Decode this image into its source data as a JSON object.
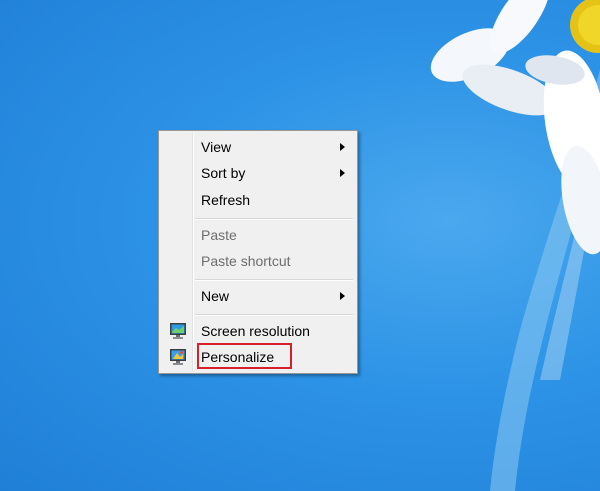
{
  "desktop": {
    "context_menu": {
      "items": [
        {
          "label": "View",
          "has_submenu": true,
          "enabled": true
        },
        {
          "label": "Sort by",
          "has_submenu": true,
          "enabled": true
        },
        {
          "label": "Refresh",
          "has_submenu": false,
          "enabled": true
        },
        {
          "label": "Paste",
          "has_submenu": false,
          "enabled": false
        },
        {
          "label": "Paste shortcut",
          "has_submenu": false,
          "enabled": false
        },
        {
          "label": "New",
          "has_submenu": true,
          "enabled": true
        },
        {
          "label": "Screen resolution",
          "has_submenu": false,
          "enabled": true,
          "icon": "screen-resolution-icon"
        },
        {
          "label": "Personalize",
          "has_submenu": false,
          "enabled": true,
          "icon": "personalize-icon",
          "highlighted": true
        }
      ]
    },
    "colors": {
      "wallpaper": "#2d93e6",
      "menu_background": "#f0f0f0",
      "highlight_box": "#d6202a"
    }
  }
}
